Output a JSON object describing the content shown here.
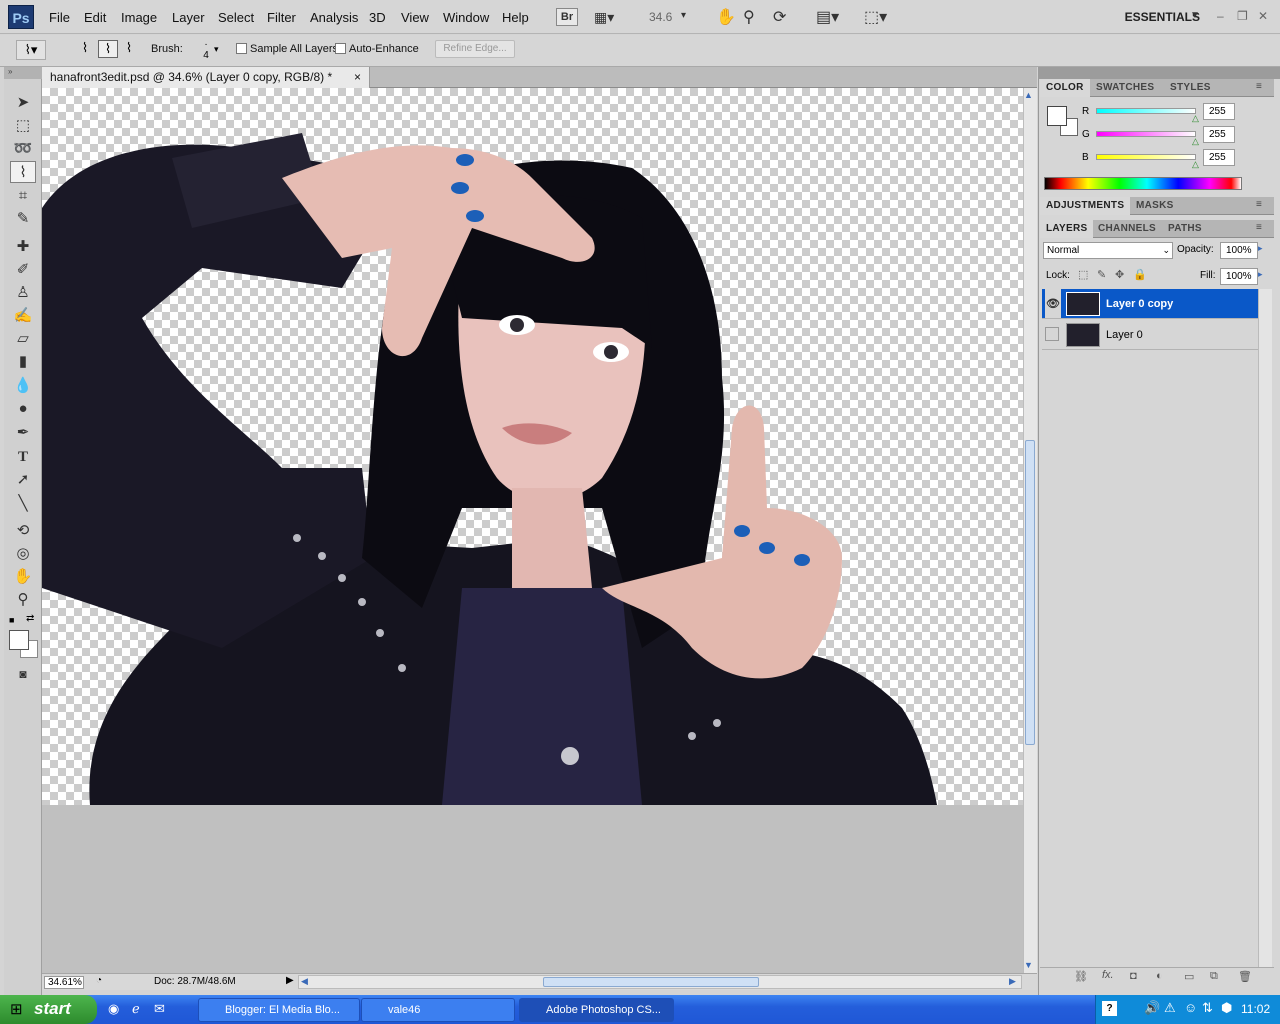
{
  "app": {
    "logo": "Ps"
  },
  "menu": [
    "File",
    "Edit",
    "Image",
    "Layer",
    "Select",
    "Filter",
    "Analysis",
    "3D",
    "View",
    "Window",
    "Help"
  ],
  "toolbar": {
    "bridge": "Br",
    "zoom": "34.6",
    "workspace": "ESSENTIALS"
  },
  "options": {
    "brush_label": "Brush:",
    "brush_size": "4",
    "sample_all": "Sample All Layers",
    "auto_enhance": "Auto-Enhance",
    "refine": "Refine Edge..."
  },
  "document": {
    "tab": "hanafront3edit.psd @ 34.6% (Layer 0 copy, RGB/8) *",
    "close": "×"
  },
  "status": {
    "zoom": "34.61%",
    "doc": "Doc: 28.7M/48.6M"
  },
  "color_panel": {
    "tabs": [
      "COLOR",
      "SWATCHES",
      "STYLES"
    ],
    "r_label": "R",
    "g_label": "G",
    "b_label": "B",
    "r": "255",
    "g": "255",
    "b": "255"
  },
  "adjust_panel": {
    "tabs": [
      "ADJUSTMENTS",
      "MASKS"
    ]
  },
  "layers_panel": {
    "tabs": [
      "LAYERS",
      "CHANNELS",
      "PATHS"
    ],
    "blend": "Normal",
    "opacity_label": "Opacity:",
    "opacity": "100%",
    "lock_label": "Lock:",
    "fill_label": "Fill:",
    "fill": "100%",
    "layers": [
      {
        "name": "Layer 0 copy",
        "visible": true,
        "selected": true
      },
      {
        "name": "Layer 0",
        "visible": false,
        "selected": false
      }
    ]
  },
  "taskbar": {
    "start": "start",
    "tasks": [
      "Blogger: El Media Blo...",
      "vale46",
      "Adobe Photoshop CS..."
    ],
    "clock": "11:02"
  },
  "colors": {
    "selection": "#0a58c8",
    "taskbar": "#245edb",
    "start": "#3a9d3a"
  }
}
